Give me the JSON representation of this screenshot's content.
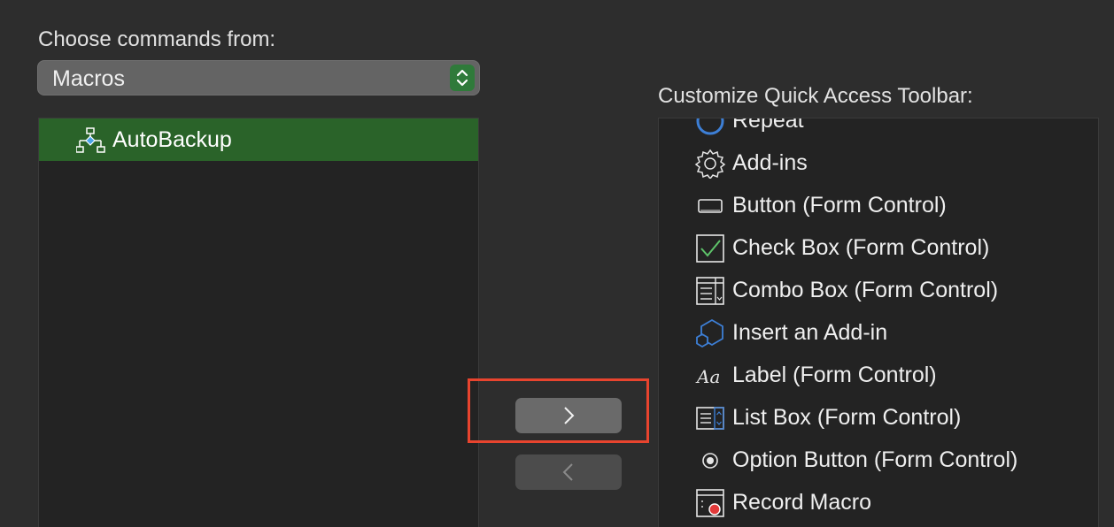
{
  "left_panel": {
    "label": "Choose commands from:",
    "select_value": "Macros",
    "items": [
      {
        "label": "AutoBackup",
        "icon": "macro-flowchart-icon",
        "selected": true
      }
    ]
  },
  "right_panel": {
    "label": "Customize Quick Access Toolbar:",
    "items": [
      {
        "label": "Repeat",
        "icon": "repeat-icon"
      },
      {
        "label": "Add-ins",
        "icon": "gear-icon"
      },
      {
        "label": "Button (Form Control)",
        "icon": "button-control-icon"
      },
      {
        "label": "Check Box (Form Control)",
        "icon": "checkbox-icon"
      },
      {
        "label": "Combo Box (Form Control)",
        "icon": "combo-box-icon"
      },
      {
        "label": "Insert an Add-in",
        "icon": "hexagon-addin-icon"
      },
      {
        "label": "Label (Form Control)",
        "icon": "label-aa-icon"
      },
      {
        "label": "List Box (Form Control)",
        "icon": "list-box-icon"
      },
      {
        "label": "Option Button (Form Control)",
        "icon": "radio-button-icon"
      },
      {
        "label": "Record Macro",
        "icon": "record-macro-icon"
      }
    ]
  },
  "buttons": {
    "add_icon": "chevron-right-icon",
    "remove_icon": "chevron-left-icon"
  },
  "colors": {
    "background": "#2d2d2d",
    "selection": "#2a6329",
    "highlight_box": "#e8442e"
  }
}
